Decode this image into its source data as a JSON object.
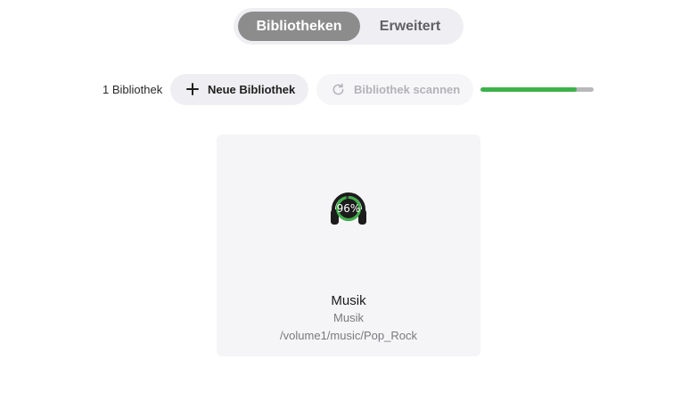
{
  "tabs": {
    "libraries_label": "Bibliotheken",
    "advanced_label": "Erweitert",
    "active": "Bibliotheken"
  },
  "toolbar": {
    "library_count": "1 Bibliothek",
    "new_library_label": "Neue Bibliothek",
    "scan_library_label": "Bibliothek scannen",
    "scan_progress": 0.85
  },
  "library": {
    "icon": "headphones-icon",
    "progress_text": "96%",
    "progress": 0.96,
    "name": "Musik",
    "type": "Musik",
    "path": "/volume1/music/Pop_Rock"
  },
  "colors": {
    "accent_green": "#3fb14a",
    "tab_active_bg": "#8c8c8c",
    "pill_bg": "#efeff3",
    "card_bg": "#f5f5f7"
  }
}
